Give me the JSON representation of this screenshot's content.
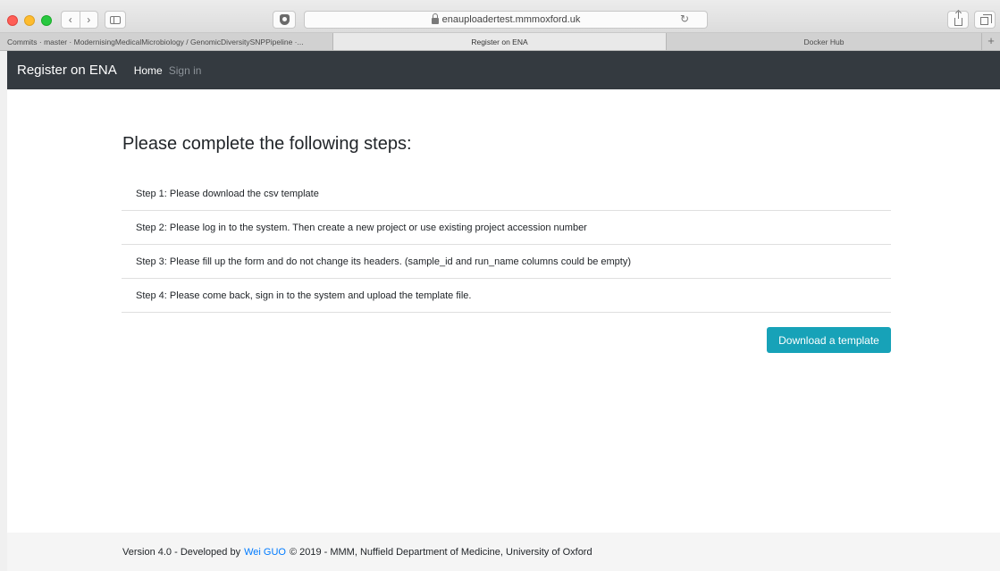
{
  "browser": {
    "url": "enauploadertest.mmmoxford.uk",
    "tabs": [
      {
        "label": "Commits · master · ModernisingMedicalMicrobiology / GenomicDiversitySNPPipeline ·..."
      },
      {
        "label": "Register on ENA"
      },
      {
        "label": "Docker Hub"
      }
    ],
    "new_tab_glyph": "+",
    "back_glyph": "‹",
    "forward_glyph": "›",
    "reload_glyph": "↻"
  },
  "navbar": {
    "brand": "Register on ENA",
    "links": [
      {
        "label": "Home"
      },
      {
        "label": "Sign in"
      }
    ]
  },
  "main": {
    "heading": "Please complete the following steps:",
    "steps": [
      "Step 1: Please download the csv template",
      "Step 2: Please log in to the system. Then create a new project or use existing project accession number",
      "Step 3: Please fill up the form and do not change its headers. (sample_id and run_name columns could be empty)",
      "Step 4: Please come back, sign in to the system and upload the template file."
    ],
    "download_label": "Download a template"
  },
  "footer": {
    "prefix": "Version 4.0 - Developed by",
    "author": "Wei GUO",
    "suffix": "© 2019 - MMM, Nuffield Department of Medicine, University of Oxford"
  },
  "colors": {
    "navbar_bg": "#343a40",
    "button_bg": "#17a2b8",
    "link": "#007bff",
    "footer_bg": "#f5f5f5"
  }
}
